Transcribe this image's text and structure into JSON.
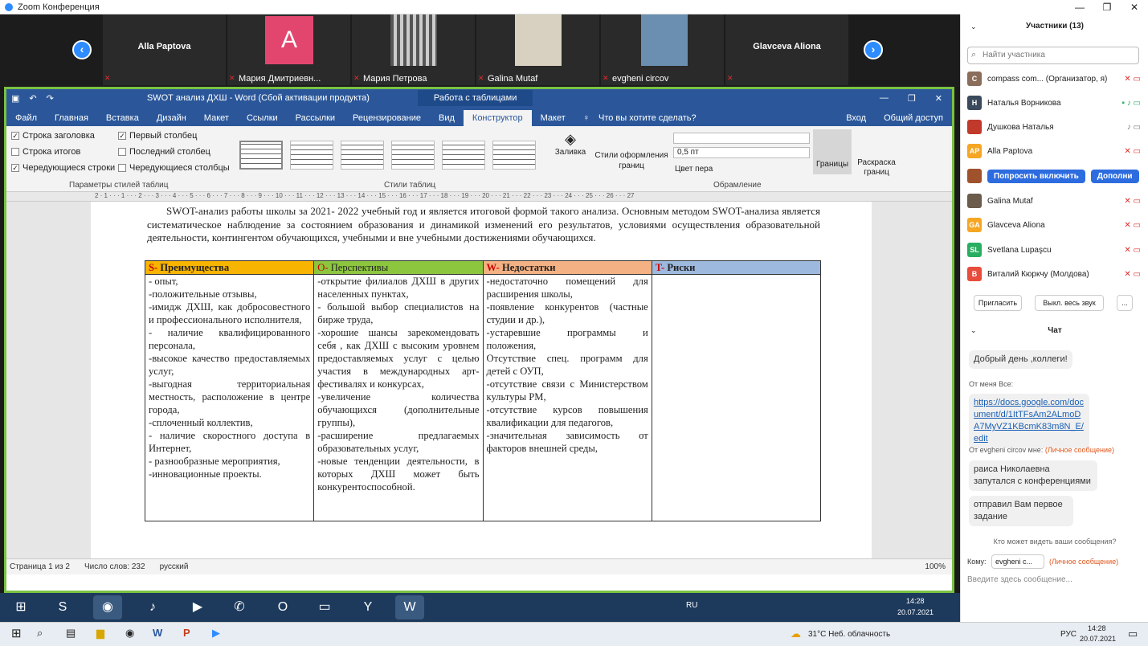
{
  "zoom": {
    "title": "Zoom Конференция",
    "participants_strip": [
      {
        "name": "Alla Paptova"
      },
      {
        "name": "Мария Дмитриевн...",
        "initial": "A"
      },
      {
        "name": "Мария Петрова"
      },
      {
        "name": "Galina Mutaf"
      },
      {
        "name": "evgheni circov"
      },
      {
        "name": "Glavceva Aliona"
      }
    ]
  },
  "word": {
    "title": "SWOT анализ ДХШ - Word (Сбой активации продукта)",
    "context_tab": "Работа с таблицами",
    "tabs": [
      "Файл",
      "Главная",
      "Вставка",
      "Дизайн",
      "Макет",
      "Ссылки",
      "Рассылки",
      "Рецензирование",
      "Вид",
      "Конструктор",
      "Макет"
    ],
    "tell_me": "Что вы хотите сделать?",
    "signin": "Вход",
    "share": "Общий доступ",
    "style_options": [
      "Строка заголовка",
      "Первый столбец",
      "Строка итогов",
      "Последний столбец",
      "Чередующиеся строки",
      "Чередующиеся столбцы"
    ],
    "group_labels": {
      "options": "Параметры стилей таблиц",
      "styles": "Стили таблиц",
      "borders": "Обрамление"
    },
    "ribbon_buttons": {
      "shading": "Заливка",
      "border_styles": "Стили оформления границ",
      "pen_weight": "0,5 пт",
      "pen_color": "Цвет пера",
      "borders": "Границы",
      "painter": "Раскраска границ"
    },
    "ruler": "2 · 1 · · · 1 · · · 2 · · · 3 · · · 4 · · · 5 · · · 6 · · · 7 · · · 8 · · · 9 · · · 10 · · · 11 · · · 12 · · · 13 · · · 14 · · · 15 · · · 16 · · · 17 · · · 18 · · · 19 · · · 20 · · · 21 · · · 22 · · · 23 · · · 24 · · · 25 · · · 26 · · · 27",
    "paragraph": "SWOT-анализ работы школы за 2021- 2022 учебный год и является итоговой формой такого анализа. Основным методом SWOT-анализа является систематическое наблюдение за состоянием образования и динамикой изменений его результатов, условиями осуществления образовательной деятельности, контингентом обучающихся, учебными и вне учебными достижениями обучающихся.",
    "table": {
      "headers": [
        {
          "letter": "S-",
          "text": "Преимущества",
          "bg": "#f7b400"
        },
        {
          "letter": "O-",
          "text": "Перспективы",
          "bg": "#8cc63f"
        },
        {
          "letter": "W-",
          "text": "Недостатки",
          "bg": "#f4b183"
        },
        {
          "letter": "T-",
          "text": "Риски",
          "bg": "#9db9de"
        }
      ],
      "cells": [
        "- опыт,\n-положительные отзывы,\n-имидж ДХШ, как добросовестного и профессионального исполнителя,\n- наличие квалифицированного персонала,\n-высокое качество предоставляемых услуг,\n-выгодная территориальная местность, расположение в центре города,\n-сплоченный коллектив,\n- наличие скоростного доступа в Интернет,\n- разнообразные мероприятия,\n-инновационные проекты.",
        "-открытие филиалов ДХШ в других населенных пунктах,\n- большой выбор специалистов на бирже труда,\n-хорошие шансы зарекомендовать себя , как ДХШ с высоким уровнем предоставляемых услуг с целью участия в международных арт-фестивалях и конкурсах,\n-увеличение количества обучающихся (дополнительные группы),\n-расширение предлагаемых образовательных услуг,\n-новые тенденции деятельности, в которых ДХШ может быть конкурентоспособной.",
        "-недостаточно помещений для расширения школы,\n-появление конкурентов (частные студии и др.),\n-устаревшие программы и положения,\nОтсутствие спец. программ для детей с ОУП,\n-отсутствие связи с Министерством культуры РМ,\n-отсутствие курсов повышения квалификации для педагогов,\n-значительная зависимость от факторов внешней среды,",
        ""
      ]
    },
    "status": {
      "page": "Страница 1 из 2",
      "words": "Число слов: 232",
      "lang": "русский",
      "zoom": "100%"
    }
  },
  "panel": {
    "participants_title": "Участники (13)",
    "search_placeholder": "Найти участника",
    "participants": [
      {
        "initials": "C",
        "name": "compass com... (Организатор, я)",
        "color": "#8a6d5a"
      },
      {
        "initials": "Н",
        "name": "Наталья Ворникова",
        "color": "#3a4a5c"
      },
      {
        "initials": "",
        "name": "Душкова Наталья",
        "color": "#c0392b"
      },
      {
        "initials": "AP",
        "name": "Alla Paptova",
        "color": "#f5a623"
      },
      {
        "initials": "",
        "name": "",
        "color": "#a0522d"
      },
      {
        "initials": "",
        "name": "Galina Mutaf",
        "color": "#6b5b4b"
      },
      {
        "initials": "GA",
        "name": "Glavceva Aliona",
        "color": "#f5a623"
      },
      {
        "initials": "SL",
        "name": "Svetlana Lupaşcu",
        "color": "#27ae60"
      },
      {
        "initials": "В",
        "name": "Виталий Кюркчу (Молдова)",
        "color": "#e74c3c"
      }
    ],
    "ask_unmute": "Попросить включить",
    "more": "Дополни",
    "invite": "Пригласить",
    "mute_all": "Выкл. весь звук",
    "ellipsis": "...",
    "chat_title": "Чат",
    "messages": [
      {
        "text": "Добрый день ,коллеги!"
      },
      {
        "from": "От меня Все:"
      },
      {
        "link": "https://docs.google.com/document/d/1ItTFsAm2ALmoDA7MyVZ1KBcmK83m8N_E/edit"
      },
      {
        "from": "От evgheni circov мне:",
        "private": "(Личное сообщение)"
      },
      {
        "text": "раиса Николаевна запутался с конференциями"
      },
      {
        "text": "отправил Вам первое задание"
      }
    ],
    "who_can_see": "Кто может видеть ваши сообщения?",
    "to_label": "Кому:",
    "to_value": "evgheni c...",
    "private_label": "(Личное сообщение)",
    "input_placeholder": "Введите здесь сообщение..."
  },
  "taskbar": {
    "inner_time": "14:28",
    "inner_date": "20.07.2021",
    "inner_lang": "RU",
    "weather": "31°C  Неб. облачность",
    "lang": "РУС",
    "time": "14:28",
    "date": "20.07.2021"
  }
}
